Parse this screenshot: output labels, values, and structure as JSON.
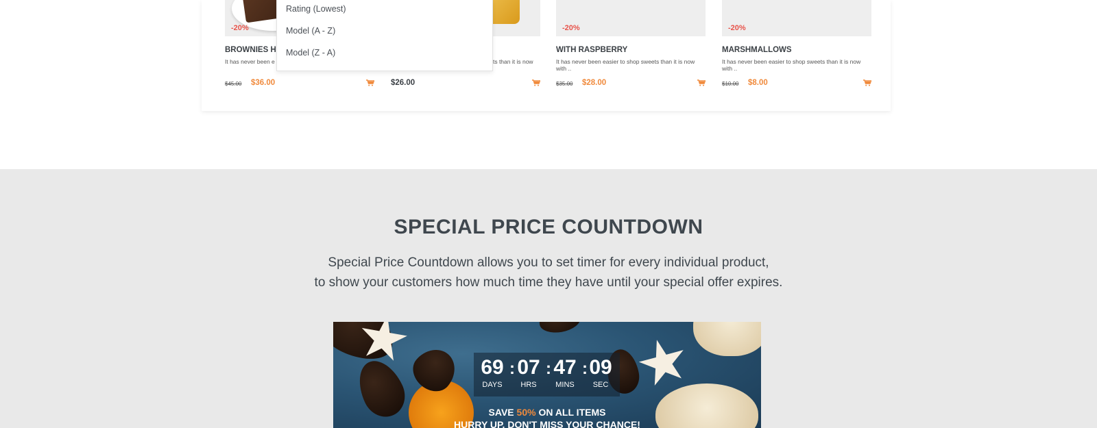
{
  "products": [
    {
      "badge": "-20%",
      "name": "BROWNIES H",
      "desc": "It has never been e with ..",
      "old_price": "$45.00",
      "price": "$36.00"
    },
    {
      "badge": "",
      "name": "",
      "desc": "sets than it is now",
      "old_price": "",
      "price": "$26.00"
    },
    {
      "badge": "-20%",
      "name": "WITH RASPBERRY",
      "desc": "It has never been easier to shop sweets than it is now with ..",
      "old_price": "$35.00",
      "price": "$28.00"
    },
    {
      "badge": "-20%",
      "name": "MARSHMALLOWS",
      "desc": "It has never been easier to shop sweets than it is now with ..",
      "old_price": "$10.00",
      "price": "$8.00"
    }
  ],
  "sort_dropdown": {
    "options": [
      "Rating (Lowest)",
      "Model (A - Z)",
      "Model (Z - A)"
    ]
  },
  "countdown_section": {
    "title": "SPECIAL PRICE COUNTDOWN",
    "subtitle_line1": "Special Price Countdown allows you to set timer for every individual product,",
    "subtitle_line2": "to show your customers how much time they have until your special offer expires.",
    "timer": {
      "days": "69",
      "days_label": "DAYS",
      "hrs": "07",
      "hrs_label": "HRS",
      "mins": "47",
      "mins_label": "MINS",
      "sec": "09",
      "sec_label": "SEC",
      "separator": ":"
    },
    "promo_prefix": "SAVE ",
    "promo_percent": "50%",
    "promo_suffix": " ON ALL ITEMS",
    "promo_line2": "HURRY UP, DON'T MISS YOUR CHANCE!"
  },
  "colors": {
    "accent": "#f08a3c",
    "badge": "#e8534a",
    "section_bg": "#e9e9e9",
    "heading": "#3f474e"
  },
  "icons": {
    "cart": "cart-icon"
  }
}
